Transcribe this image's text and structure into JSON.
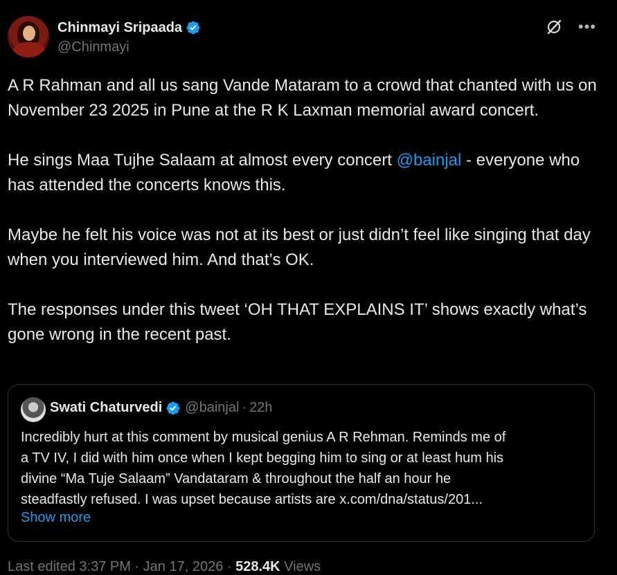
{
  "author": {
    "display_name": "Chinmayi Sripaada",
    "handle": "@Chinmayi",
    "verified": true
  },
  "tweet": {
    "p1": "A R Rahman and all us sang Vande Mataram to a crowd that chanted with us on November 23 2025 in Pune at the R K Laxman memorial award concert.",
    "p2_before": "He sings Maa Tujhe Salaam at almost every concert ",
    "p2_mention": "@bainjal",
    "p2_after": " - everyone who has attended the concerts knows this.",
    "p3": "Maybe he felt his voice was not at its best or just didn’t feel like singing that day when you interviewed him. And that’s OK.",
    "p4": "The responses under this tweet  ‘OH THAT EXPLAINS IT’ shows exactly what’s gone wrong in the recent past."
  },
  "quote": {
    "display_name": "Swati Chaturvedi",
    "handle": "@bainjal",
    "separator": "·",
    "time": "22h",
    "lines": [
      "Incredibly hurt at this comment by musical genius A R Rehman. Reminds me of",
      "a TV IV, I did with him once when I kept begging him to sing or at least hum his",
      "divine “Ma Tuje Salaam” Vandataram & throughout the half an hour he",
      "steadfastly refused. I was upset because artists are x.com/dna/status/201..."
    ],
    "show_more": "Show more"
  },
  "meta": {
    "edited": "Last edited 3:37 PM · Jan 17, 2026 · ",
    "views": "528.4K",
    "views_label": " Views"
  },
  "colors": {
    "background": "#000000",
    "text": "#e7e9ea",
    "secondary": "#71767b",
    "accent": "#1d9bf0",
    "border": "#2f3336"
  },
  "icons": [
    "verified-badge-icon",
    "grok-icon",
    "more-options-icon"
  ]
}
